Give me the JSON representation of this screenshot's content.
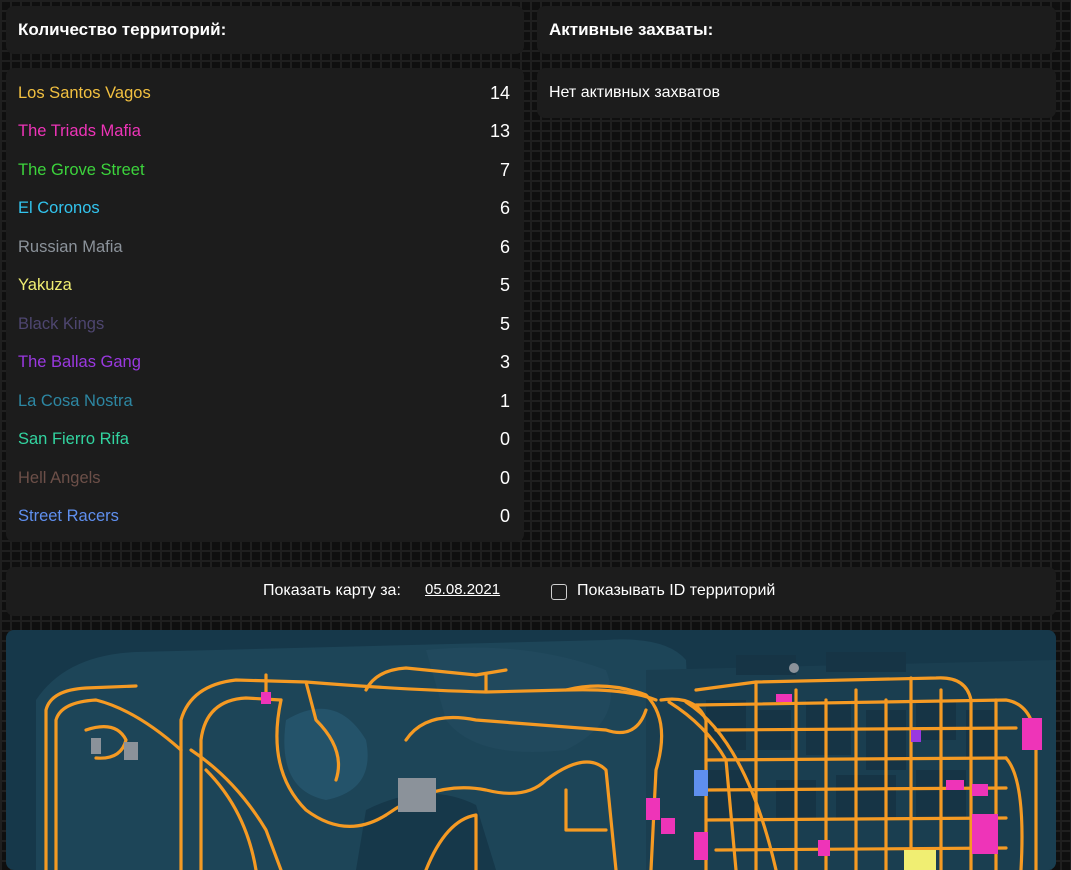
{
  "territories": {
    "title": "Количество территорий:",
    "items": [
      {
        "name": "Los Santos Vagos",
        "count": "14",
        "color": "#f2c040"
      },
      {
        "name": "The Triads Mafia",
        "count": "13",
        "color": "#ee34b8"
      },
      {
        "name": "The Grove Street",
        "count": "7",
        "color": "#3cd33c"
      },
      {
        "name": "El Coronos",
        "count": "6",
        "color": "#32c4ee"
      },
      {
        "name": "Russian Mafia",
        "count": "6",
        "color": "#8b929a"
      },
      {
        "name": "Yakuza",
        "count": "5",
        "color": "#f0ee72"
      },
      {
        "name": "Black Kings",
        "count": "5",
        "color": "#4e4670"
      },
      {
        "name": "The Ballas Gang",
        "count": "3",
        "color": "#9a38e0"
      },
      {
        "name": "La Cosa Nostra",
        "count": "1",
        "color": "#2d87a3"
      },
      {
        "name": "San Fierro Rifa",
        "count": "0",
        "color": "#32d4a0"
      },
      {
        "name": "Hell Angels",
        "count": "0",
        "color": "#6c4f48"
      },
      {
        "name": "Street Racers",
        "count": "0",
        "color": "#5f8fee"
      }
    ]
  },
  "captures": {
    "title": "Активные захваты:",
    "empty_text": "Нет активных захватов"
  },
  "map_controls": {
    "show_map_label": "Показать карту за:",
    "date": "05.08.2021",
    "show_ids_label": "Показывать ID территорий",
    "show_ids_checked": false
  },
  "colors": {
    "panel": "#1c1c1c",
    "road": "#f59a23",
    "water": "#16384a",
    "land": "#1d4558"
  }
}
